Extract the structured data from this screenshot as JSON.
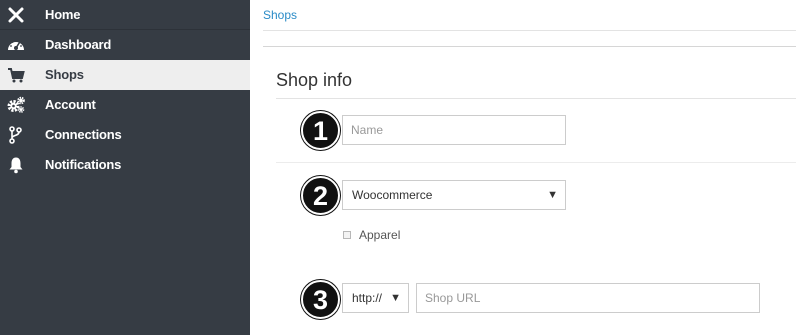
{
  "sidebar": {
    "items": [
      {
        "label": "Home",
        "icon": "close-icon"
      },
      {
        "label": "Dashboard",
        "icon": "dashboard-icon"
      },
      {
        "label": "Shops",
        "icon": "cart-icon",
        "active": true
      },
      {
        "label": "Account",
        "icon": "gears-icon"
      },
      {
        "label": "Connections",
        "icon": "branch-icon"
      },
      {
        "label": "Notifications",
        "icon": "bell-icon"
      }
    ]
  },
  "breadcrumb": "Shops",
  "section": {
    "title": "Shop info"
  },
  "form": {
    "name": {
      "placeholder": "Name",
      "value": ""
    },
    "platform": {
      "selected": "Woocommerce"
    },
    "apparel": {
      "label": "Apparel",
      "checked": false
    },
    "protocol": {
      "selected": "http://"
    },
    "url": {
      "placeholder": "Shop URL",
      "value": ""
    }
  },
  "badges": [
    "1",
    "2",
    "3"
  ],
  "colors": {
    "sidebar_bg": "#363c44",
    "active_item_bg": "#eeeeee",
    "link": "#2a8bc7",
    "badge_bg": "#111111"
  }
}
